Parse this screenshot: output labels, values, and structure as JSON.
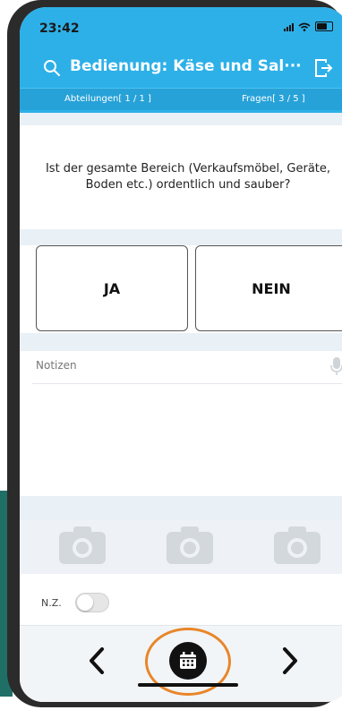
{
  "status": {
    "time": "23:42"
  },
  "header": {
    "title": "Bedienung: Käse und Sal···",
    "departments": "Abteilungen[ 1 / 1 ]",
    "questions": "Fragen[ 3 / 5 ]"
  },
  "question": {
    "text": "Ist der gesamte Bereich (Verkaufsmöbel, Geräte, Boden etc.) ordentlich und sauber?"
  },
  "answers": {
    "yes": "JA",
    "no": "NEIN"
  },
  "notes": {
    "placeholder": "Notizen"
  },
  "nz": {
    "label": "N.Z.",
    "enabled": false
  },
  "colors": {
    "header": "#2db0e8",
    "highlight": "#e8862a"
  },
  "icons": [
    "search-icon",
    "exit-icon",
    "mic-icon",
    "camera-icon",
    "chevron-left-icon",
    "calendar-icon",
    "chevron-right-icon"
  ]
}
